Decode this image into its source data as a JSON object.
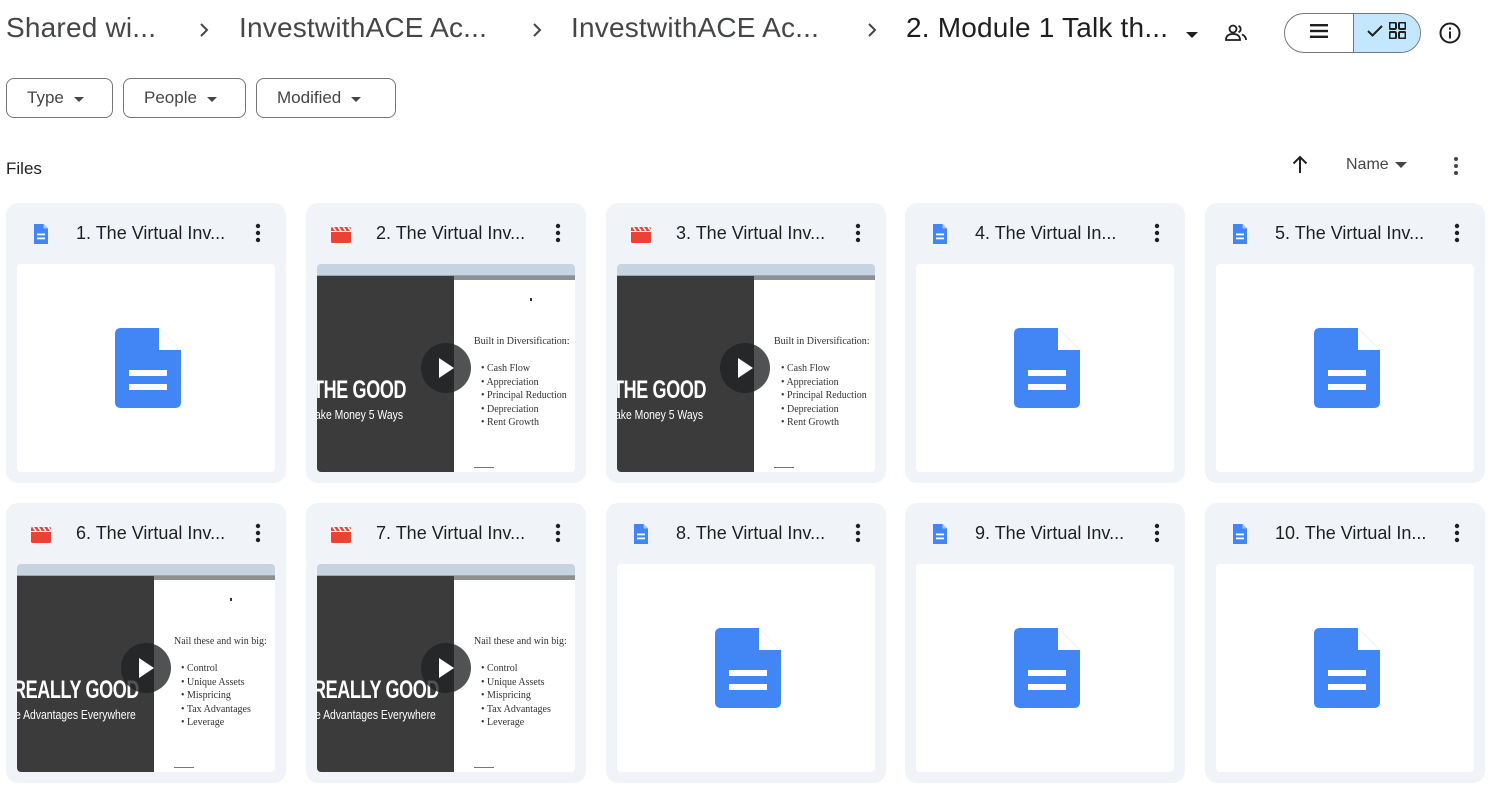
{
  "breadcrumb": {
    "items": [
      {
        "label": "Shared wi..."
      },
      {
        "label": "InvestwithACE Ac..."
      },
      {
        "label": "InvestwithACE Ac..."
      },
      {
        "label": "2. Module 1 Talk th..."
      }
    ]
  },
  "toolbar": {
    "share_icon": "people-icon",
    "list_view_icon": "list-icon",
    "grid_view_icon": "grid-icon",
    "info_icon": "info-icon"
  },
  "filters": [
    {
      "label": "Type"
    },
    {
      "label": "People"
    },
    {
      "label": "Modified"
    }
  ],
  "files_section": {
    "label": "Files",
    "sort_label": "Name",
    "sort_direction": "ascending"
  },
  "files": [
    {
      "title": "1. The Virtual Inv...",
      "kind": "doc"
    },
    {
      "title": "2. The Virtual Inv...",
      "kind": "video",
      "thumb": {
        "big": "THE GOOD",
        "small": "ake Money 5 Ways",
        "heading": "Built in Diversification:",
        "items": [
          "Cash Flow",
          "Appreciation",
          "Principal Reduction",
          "Depreciation",
          "Rent Growth"
        ]
      }
    },
    {
      "title": "3. The Virtual Inv...",
      "kind": "video",
      "thumb": {
        "big": "THE GOOD",
        "small": "ake Money 5 Ways",
        "heading": "Built in Diversification:",
        "items": [
          "Cash Flow",
          "Appreciation",
          "Principal Reduction",
          "Depreciation",
          "Rent Growth"
        ]
      }
    },
    {
      "title": "4. The Virtual In...",
      "kind": "doc"
    },
    {
      "title": "5. The Virtual Inv...",
      "kind": "doc"
    },
    {
      "title": "6. The Virtual Inv...",
      "kind": "video",
      "thumb": {
        "big": "REALLY GOOD",
        "small": "e Advantages Everywhere",
        "heading": "Nail these and win big:",
        "items": [
          "Control",
          "Unique Assets",
          "Mispricing",
          "Tax Advantages",
          "Leverage"
        ]
      }
    },
    {
      "title": "7. The Virtual Inv...",
      "kind": "video",
      "thumb": {
        "big": "REALLY GOOD",
        "small": "e Advantages Everywhere",
        "heading": "Nail these and win big:",
        "items": [
          "Control",
          "Unique Assets",
          "Mispricing",
          "Tax Advantages",
          "Leverage"
        ]
      }
    },
    {
      "title": "8. The Virtual Inv...",
      "kind": "doc"
    },
    {
      "title": "9. The Virtual Inv...",
      "kind": "doc"
    },
    {
      "title": "10. The Virtual In...",
      "kind": "doc"
    }
  ],
  "colors": {
    "doc_blue": "#4285f4",
    "video_red": "#ea4335",
    "card_bg": "#f0f4f9",
    "active_toggle": "#c2e7ff"
  }
}
